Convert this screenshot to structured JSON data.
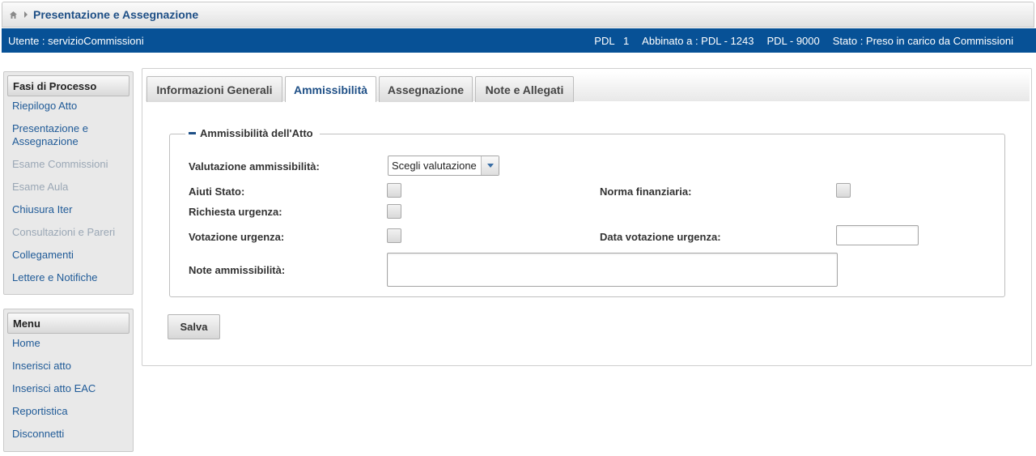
{
  "breadcrumb": {
    "title": "Presentazione e Assegnazione"
  },
  "userbar": {
    "user": "Utente : servizioCommissioni",
    "pdl": "PDL   1",
    "abbinato": "Abbinato a : PDL - 1243",
    "pdl2": "PDL - 9000",
    "stato": "Stato : Preso in carico da Commissioni"
  },
  "fasi": {
    "title": "Fasi di Processo",
    "items": [
      {
        "label": "Riepilogo Atto"
      },
      {
        "label": "Presentazione e Assegnazione"
      },
      {
        "label": "Esame Commissioni"
      },
      {
        "label": "Esame Aula"
      },
      {
        "label": "Chiusura Iter"
      },
      {
        "label": "Consultazioni e Pareri"
      },
      {
        "label": "Collegamenti"
      },
      {
        "label": "Lettere e Notifiche"
      }
    ]
  },
  "menu": {
    "title": "Menu",
    "items": [
      {
        "label": "Home"
      },
      {
        "label": "Inserisci atto"
      },
      {
        "label": "Inserisci atto EAC"
      },
      {
        "label": "Reportistica"
      },
      {
        "label": "Disconnetti"
      }
    ]
  },
  "tabs": [
    {
      "label": "Informazioni Generali"
    },
    {
      "label": "Ammissibilità"
    },
    {
      "label": "Assegnazione"
    },
    {
      "label": "Note e Allegati"
    }
  ],
  "form": {
    "legend": "Ammissibilità dell'Atto",
    "valutazione_label": "Valutazione ammissibilità:",
    "valutazione_value": "Scegli valutazione",
    "aiuti_label": "Aiuti Stato:",
    "norma_label": "Norma finanziaria:",
    "richiesta_label": "Richiesta urgenza:",
    "votazione_label": "Votazione urgenza:",
    "data_votazione_label": "Data votazione urgenza:",
    "note_label": "Note ammissibilità:",
    "save_label": "Salva"
  }
}
